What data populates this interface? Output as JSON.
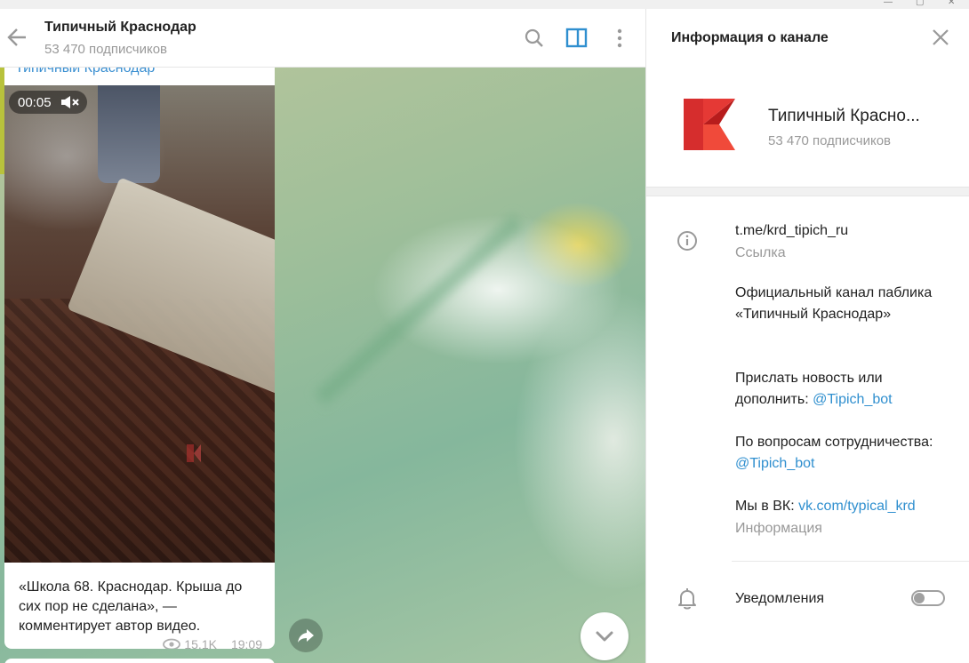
{
  "chat": {
    "title": "Типичный Краснодар",
    "subscribers": "53 470 подписчиков"
  },
  "message": {
    "author": "Типичный Краснодар",
    "video_time": "00:05",
    "caption": "«Школа 68. Краснодар. Крыша до сих пор не сделана», — комментирует автор видео.",
    "views": "15.1K",
    "time": "19:09"
  },
  "panel": {
    "title": "Информация о канале",
    "channel_name": "Типичный Красно...",
    "channel_subscribers": "53 470 подписчиков",
    "link": "t.me/krd_tipich_ru",
    "link_label": "Ссылка",
    "description_1": "Официальный канал паблика «Типичный Краснодар»",
    "description_2_prefix": "Прислать новость или дополнить: ",
    "description_2_link": "@Tipich_bot",
    "description_3_prefix": "По вопросам сотрудничества: ",
    "description_3_link": "@Tipich_bot",
    "description_4_prefix": "Мы в ВК: ",
    "description_4_link": "vk.com/typical_krd",
    "info_label": "Информация",
    "notifications_label": "Уведомления",
    "notifications_on": false
  },
  "icons": {
    "back": "arrow-left-icon",
    "search": "search-icon",
    "sidebar": "sidebar-toggle-icon",
    "menu": "more-vertical-icon",
    "close": "close-icon",
    "info": "info-icon",
    "bell": "bell-icon",
    "share": "share-icon",
    "scroll_down": "chevron-down-icon",
    "mute": "mute-icon",
    "views": "eye-icon"
  },
  "colors": {
    "accent": "#2f8fcf",
    "sidebar_icon": "#2f8fcf",
    "logo_red": "#e53935"
  }
}
